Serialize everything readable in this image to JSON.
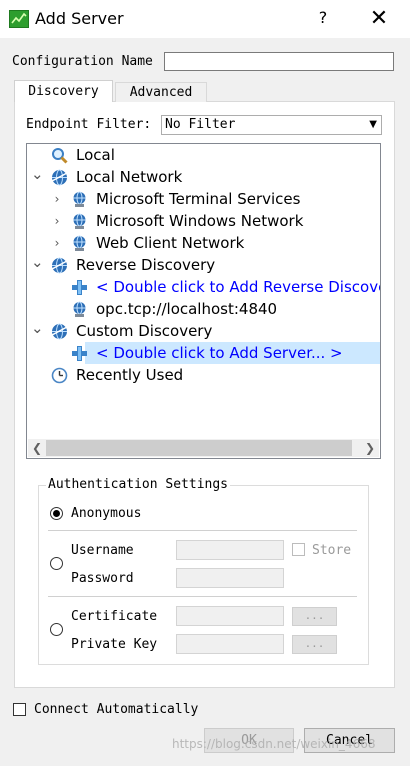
{
  "window": {
    "title": "Add Server",
    "help_label": "?",
    "close_label": "✕"
  },
  "config": {
    "label": "Configuration Name",
    "value": ""
  },
  "tabs": [
    {
      "label": "Discovery",
      "active": true
    },
    {
      "label": "Advanced",
      "active": false
    }
  ],
  "filter": {
    "label": "Endpoint Filter:",
    "value": "No Filter"
  },
  "tree": [
    {
      "label": "Local",
      "icon": "search-icon",
      "level": 0,
      "expander": ""
    },
    {
      "label": "Local Network",
      "icon": "network-globe-icon",
      "level": 0,
      "expander": "expanded"
    },
    {
      "label": "Microsoft Terminal Services",
      "icon": "server-globe-icon",
      "level": 1,
      "expander": "collapsed"
    },
    {
      "label": "Microsoft Windows Network",
      "icon": "server-globe-icon",
      "level": 1,
      "expander": "collapsed"
    },
    {
      "label": "Web Client Network",
      "icon": "server-globe-icon",
      "level": 1,
      "expander": "collapsed"
    },
    {
      "label": "Reverse Discovery",
      "icon": "network-globe-icon",
      "level": 0,
      "expander": "expanded"
    },
    {
      "label": "< Double click to Add Reverse Discovery... >",
      "icon": "add-plus-icon",
      "level": 1,
      "expander": "",
      "link": true
    },
    {
      "label": "opc.tcp://localhost:4840",
      "icon": "server-globe-icon",
      "level": 1,
      "expander": ""
    },
    {
      "label": "Custom Discovery",
      "icon": "network-globe-icon",
      "level": 0,
      "expander": "expanded"
    },
    {
      "label": "< Double click to Add Server... >",
      "icon": "add-plus-icon",
      "level": 1,
      "expander": "",
      "link": true,
      "selected": true
    },
    {
      "label": "Recently Used",
      "icon": "clock-icon",
      "level": 0,
      "expander": ""
    }
  ],
  "auth": {
    "title": "Authentication Settings",
    "anonymous_label": "Anonymous",
    "username_label": "Username",
    "password_label": "Password",
    "store_label": "Store",
    "certificate_label": "Certificate",
    "private_key_label": "Private Key",
    "browse_label": "...",
    "selected": "anonymous"
  },
  "connect_auto_label": "Connect Automatically",
  "buttons": {
    "ok": "OK",
    "cancel": "Cancel"
  },
  "watermark": "https://blog.csdn.net/weixin_4668"
}
